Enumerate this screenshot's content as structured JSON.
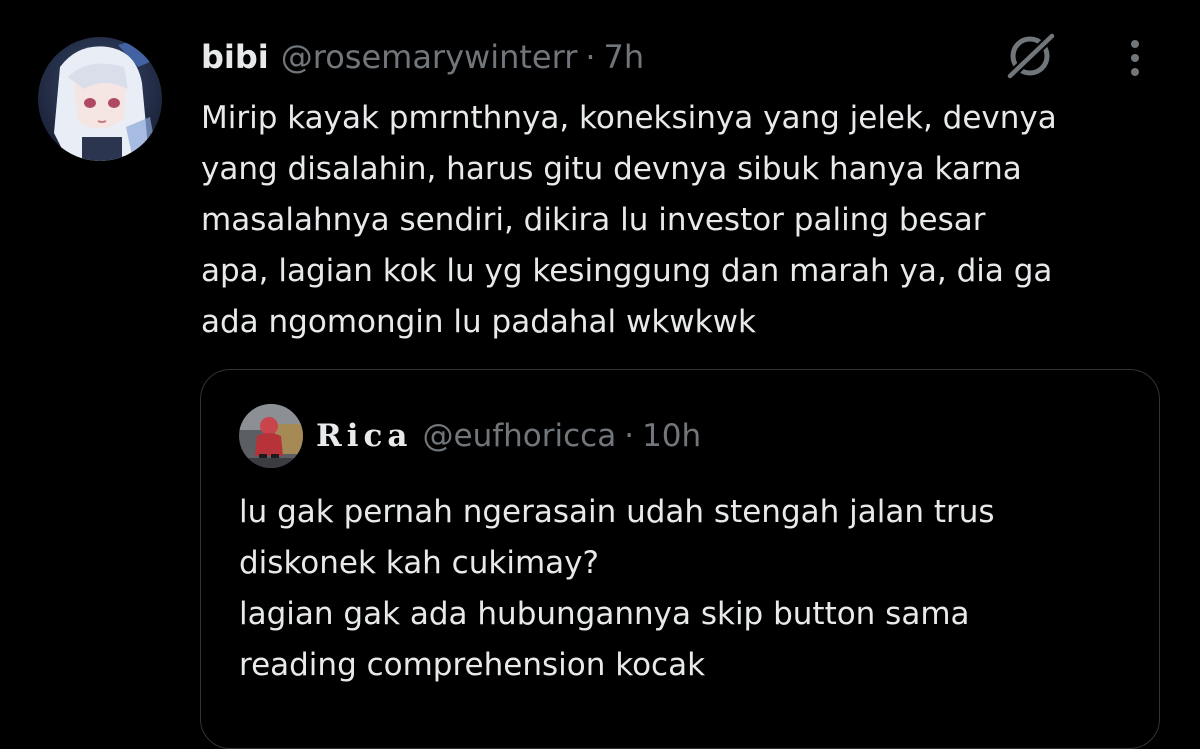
{
  "tweet": {
    "display_name": "bibi",
    "handle": "@rosemarywinterr",
    "separator": "·",
    "time": "7h",
    "text": "Mirip kayak pmrnthnya, koneksinya yang jelek, devnya\nyang disalahin, harus gitu devnya sibuk hanya karna\nmasalahnya sendiri, dikira lu investor paling besar\napa, lagian kok lu yg kesinggung dan marah ya, dia ga\nada ngomongin lu padahal wkwkwk",
    "actions": {
      "grok_icon": "grok-icon",
      "more_icon": "more-vertical-icon"
    }
  },
  "quoted": {
    "display_name": "Rica",
    "handle": "@eufhoricca",
    "separator": "·",
    "time": "10h",
    "text": "lu gak pernah ngerasain udah stengah jalan trus\ndiskonek kah cukimay?\nlagian gak ada hubungannya skip button sama\nreading comprehension kocak"
  },
  "colors": {
    "background": "#000000",
    "text_primary": "#e7e9ea",
    "text_secondary": "#71767b",
    "border": "#2f3336"
  }
}
